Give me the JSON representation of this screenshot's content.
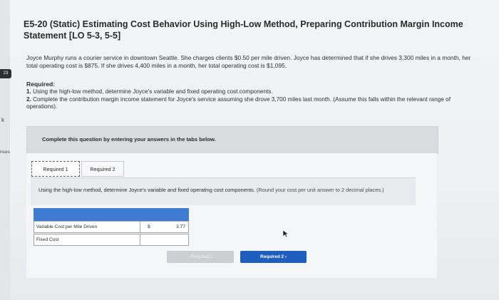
{
  "title": "E5-20 (Static) Estimating Cost Behavior Using High-Low Method, Preparing Contribution Margin Income Statement [LO 5-3, 5-5]",
  "intro": "Joyce Murphy runs a courier service in downtown Seattle. She charges clients $0.50 per mile driven. Joyce has determined that if she drives 3,300 miles in a month, her total operating cost is $875. If she drives 4,400 miles in a month, her total operating cost is $1,095.",
  "required": {
    "heading": "Required:",
    "items": [
      {
        "num": "1.",
        "text": "Using the high-low method, determine Joyce's variable and fixed operating cost components."
      },
      {
        "num": "2.",
        "text": "Complete the contribution margin income statement for Joyce's service assuming she drove 3,700 miles last month. (Assume this falls within the relevant range of operations)."
      }
    ]
  },
  "side": {
    "badge": "23",
    "k": "k",
    "ices": "nces"
  },
  "banner": "Complete this question by entering your answers in the tabs below.",
  "tabs": [
    {
      "label": "Required 1",
      "active": true
    },
    {
      "label": "Required 2",
      "active": false
    }
  ],
  "instruction": {
    "text": "Using the high-low method, determine Joyce's variable and fixed operating cost components.",
    "hint": "(Round your cost per unit answer to 2 decimal places.)"
  },
  "table": {
    "header_color": "#3f7bd0",
    "rows": [
      {
        "label": "Variable Cost per Mile Driven",
        "currency": "$",
        "value": "3.77"
      },
      {
        "label": "Fixed Cost",
        "currency": "",
        "value": ""
      }
    ]
  },
  "buttons": {
    "prev": "‹  Required 1",
    "next": "Required 2  ›"
  },
  "colors": {
    "accent": "#1d5ebf"
  }
}
